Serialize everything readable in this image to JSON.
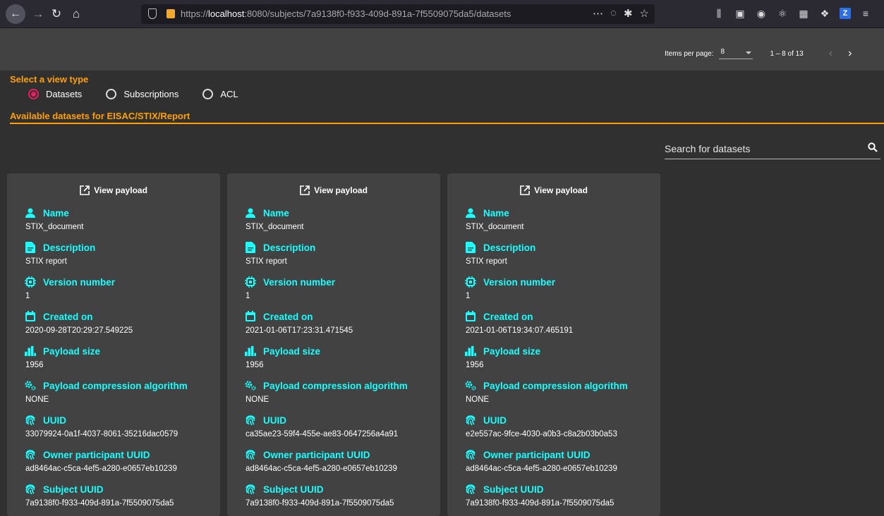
{
  "browser": {
    "url_prefix": "https://",
    "url_host": "localhost",
    "url_rest": ":8080/subjects/7a9138f0-f933-409d-891a-7f5509075da5/datasets",
    "badge_label": "Z"
  },
  "paginator": {
    "items_per_page_label": "Items per page:",
    "items_per_page_value": "8",
    "range_label": "1 – 8 of 13"
  },
  "view_type": {
    "title": "Select a view type",
    "options": [
      "Datasets",
      "Subscriptions",
      "ACL"
    ],
    "selected": "Datasets"
  },
  "available_title": "Available datasets for EISAC/STIX/Report",
  "search": {
    "placeholder": "Search for datasets"
  },
  "labels": {
    "view_payload": "View payload",
    "name": "Name",
    "description": "Description",
    "version": "Version number",
    "created": "Created on",
    "size": "Payload size",
    "compression": "Payload compression algorithm",
    "uuid": "UUID",
    "owner": "Owner participant UUID",
    "subject": "Subject UUID"
  },
  "datasets": [
    {
      "name": "STIX_document",
      "description": "STIX report",
      "version": "1",
      "created": "2020-09-28T20:29:27.549225",
      "size": "1956",
      "compression": "NONE",
      "uuid": "33079924-0a1f-4037-8061-35216dac0579",
      "owner": "ad8464ac-c5ca-4ef5-a280-e0657eb10239",
      "subject": "7a9138f0-f933-409d-891a-7f5509075da5"
    },
    {
      "name": "STIX_document",
      "description": "STIX report",
      "version": "1",
      "created": "2021-01-06T17:23:31.471545",
      "size": "1956",
      "compression": "NONE",
      "uuid": "ca35ae23-59f4-455e-ae83-0647256a4a91",
      "owner": "ad8464ac-c5ca-4ef5-a280-e0657eb10239",
      "subject": "7a9138f0-f933-409d-891a-7f5509075da5"
    },
    {
      "name": "STIX_document",
      "description": "STIX report",
      "version": "1",
      "created": "2021-01-06T19:34:07.465191",
      "size": "1956",
      "compression": "NONE",
      "uuid": "e2e557ac-9fce-4030-a0b3-c8a2b03b0a53",
      "owner": "ad8464ac-c5ca-4ef5-a280-e0657eb10239",
      "subject": "7a9138f0-f933-409d-891a-7f5509075da5"
    }
  ],
  "colors": {
    "accent": "#ffa000",
    "label": "#18ffff",
    "radio": "#e91e63",
    "card": "#424242",
    "background": "#303030"
  }
}
